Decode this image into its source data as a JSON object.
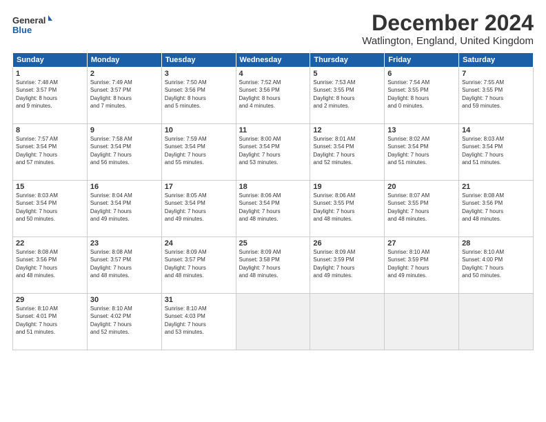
{
  "logo": {
    "line1": "General",
    "line2": "Blue"
  },
  "title": "December 2024",
  "location": "Watlington, England, United Kingdom",
  "days_of_week": [
    "Sunday",
    "Monday",
    "Tuesday",
    "Wednesday",
    "Thursday",
    "Friday",
    "Saturday"
  ],
  "weeks": [
    [
      {
        "day": "1",
        "info": "Sunrise: 7:48 AM\nSunset: 3:57 PM\nDaylight: 8 hours\nand 9 minutes."
      },
      {
        "day": "2",
        "info": "Sunrise: 7:49 AM\nSunset: 3:57 PM\nDaylight: 8 hours\nand 7 minutes."
      },
      {
        "day": "3",
        "info": "Sunrise: 7:50 AM\nSunset: 3:56 PM\nDaylight: 8 hours\nand 5 minutes."
      },
      {
        "day": "4",
        "info": "Sunrise: 7:52 AM\nSunset: 3:56 PM\nDaylight: 8 hours\nand 4 minutes."
      },
      {
        "day": "5",
        "info": "Sunrise: 7:53 AM\nSunset: 3:55 PM\nDaylight: 8 hours\nand 2 minutes."
      },
      {
        "day": "6",
        "info": "Sunrise: 7:54 AM\nSunset: 3:55 PM\nDaylight: 8 hours\nand 0 minutes."
      },
      {
        "day": "7",
        "info": "Sunrise: 7:55 AM\nSunset: 3:55 PM\nDaylight: 7 hours\nand 59 minutes."
      }
    ],
    [
      {
        "day": "8",
        "info": "Sunrise: 7:57 AM\nSunset: 3:54 PM\nDaylight: 7 hours\nand 57 minutes."
      },
      {
        "day": "9",
        "info": "Sunrise: 7:58 AM\nSunset: 3:54 PM\nDaylight: 7 hours\nand 56 minutes."
      },
      {
        "day": "10",
        "info": "Sunrise: 7:59 AM\nSunset: 3:54 PM\nDaylight: 7 hours\nand 55 minutes."
      },
      {
        "day": "11",
        "info": "Sunrise: 8:00 AM\nSunset: 3:54 PM\nDaylight: 7 hours\nand 53 minutes."
      },
      {
        "day": "12",
        "info": "Sunrise: 8:01 AM\nSunset: 3:54 PM\nDaylight: 7 hours\nand 52 minutes."
      },
      {
        "day": "13",
        "info": "Sunrise: 8:02 AM\nSunset: 3:54 PM\nDaylight: 7 hours\nand 51 minutes."
      },
      {
        "day": "14",
        "info": "Sunrise: 8:03 AM\nSunset: 3:54 PM\nDaylight: 7 hours\nand 51 minutes."
      }
    ],
    [
      {
        "day": "15",
        "info": "Sunrise: 8:03 AM\nSunset: 3:54 PM\nDaylight: 7 hours\nand 50 minutes."
      },
      {
        "day": "16",
        "info": "Sunrise: 8:04 AM\nSunset: 3:54 PM\nDaylight: 7 hours\nand 49 minutes."
      },
      {
        "day": "17",
        "info": "Sunrise: 8:05 AM\nSunset: 3:54 PM\nDaylight: 7 hours\nand 49 minutes."
      },
      {
        "day": "18",
        "info": "Sunrise: 8:06 AM\nSunset: 3:54 PM\nDaylight: 7 hours\nand 48 minutes."
      },
      {
        "day": "19",
        "info": "Sunrise: 8:06 AM\nSunset: 3:55 PM\nDaylight: 7 hours\nand 48 minutes."
      },
      {
        "day": "20",
        "info": "Sunrise: 8:07 AM\nSunset: 3:55 PM\nDaylight: 7 hours\nand 48 minutes."
      },
      {
        "day": "21",
        "info": "Sunrise: 8:08 AM\nSunset: 3:56 PM\nDaylight: 7 hours\nand 48 minutes."
      }
    ],
    [
      {
        "day": "22",
        "info": "Sunrise: 8:08 AM\nSunset: 3:56 PM\nDaylight: 7 hours\nand 48 minutes."
      },
      {
        "day": "23",
        "info": "Sunrise: 8:08 AM\nSunset: 3:57 PM\nDaylight: 7 hours\nand 48 minutes."
      },
      {
        "day": "24",
        "info": "Sunrise: 8:09 AM\nSunset: 3:57 PM\nDaylight: 7 hours\nand 48 minutes."
      },
      {
        "day": "25",
        "info": "Sunrise: 8:09 AM\nSunset: 3:58 PM\nDaylight: 7 hours\nand 48 minutes."
      },
      {
        "day": "26",
        "info": "Sunrise: 8:09 AM\nSunset: 3:59 PM\nDaylight: 7 hours\nand 49 minutes."
      },
      {
        "day": "27",
        "info": "Sunrise: 8:10 AM\nSunset: 3:59 PM\nDaylight: 7 hours\nand 49 minutes."
      },
      {
        "day": "28",
        "info": "Sunrise: 8:10 AM\nSunset: 4:00 PM\nDaylight: 7 hours\nand 50 minutes."
      }
    ],
    [
      {
        "day": "29",
        "info": "Sunrise: 8:10 AM\nSunset: 4:01 PM\nDaylight: 7 hours\nand 51 minutes."
      },
      {
        "day": "30",
        "info": "Sunrise: 8:10 AM\nSunset: 4:02 PM\nDaylight: 7 hours\nand 52 minutes."
      },
      {
        "day": "31",
        "info": "Sunrise: 8:10 AM\nSunset: 4:03 PM\nDaylight: 7 hours\nand 53 minutes."
      },
      {
        "day": "",
        "info": ""
      },
      {
        "day": "",
        "info": ""
      },
      {
        "day": "",
        "info": ""
      },
      {
        "day": "",
        "info": ""
      }
    ]
  ]
}
